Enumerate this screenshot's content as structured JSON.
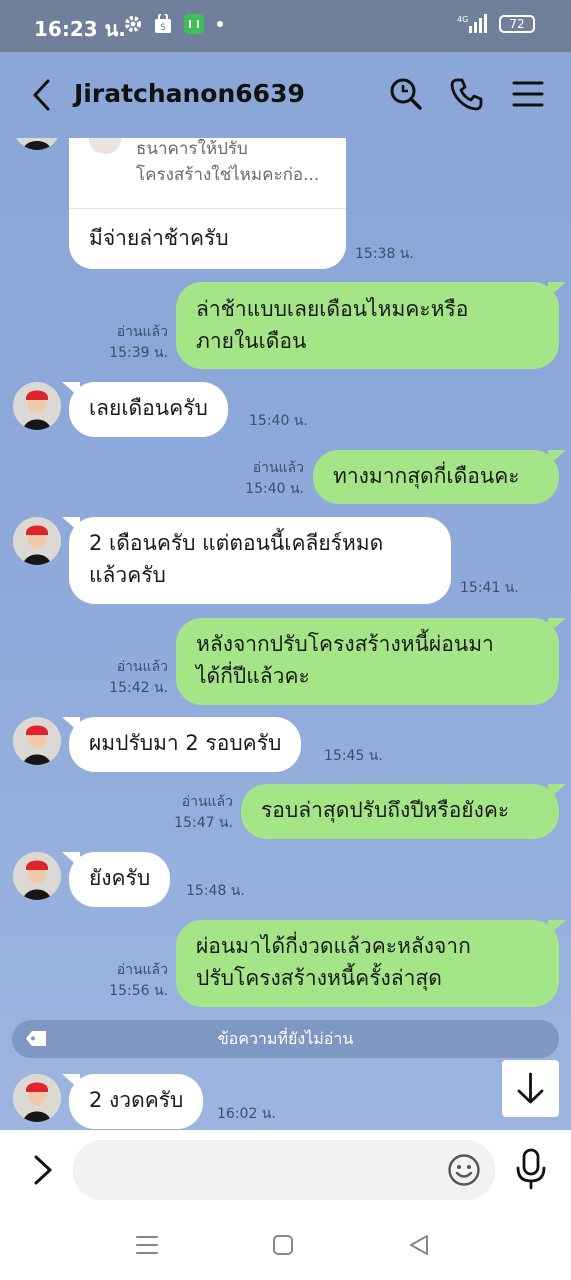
{
  "status_bar": {
    "time": "16:23 น.",
    "network": "4G",
    "battery": "72"
  },
  "header": {
    "title": "Jiratchanon6639"
  },
  "reply_card": {
    "quote_line1": "ธนาคารให้ปรับ",
    "quote_line2": "โครงสร้างใช่ไหมคะก่อ...",
    "message": "มีจ่ายล่าช้าครับ",
    "time": "15:38 น."
  },
  "messages": [
    {
      "side": "out",
      "lines": [
        "ล่าช้าแบบเลยเดือนไหมคะหรือ",
        "ภายในเดือน"
      ],
      "read": "อ่านแล้ว",
      "time": "15:39 น."
    },
    {
      "side": "in",
      "lines": [
        "เลยเดือนครับ"
      ],
      "time": "15:40 น."
    },
    {
      "side": "out",
      "lines": [
        "ทางมากสุดกี่เดือนคะ"
      ],
      "read": "อ่านแล้ว",
      "time": "15:40 น."
    },
    {
      "side": "in",
      "lines": [
        "2 เดือนครับ แต่ตอนนี้เคลียร์หมด",
        "แล้วครับ"
      ],
      "time": "15:41 น."
    },
    {
      "side": "out",
      "lines": [
        "หลังจากปรับโครงสร้างหนี้ผ่อนมา",
        "ได้กี่ปีแล้วคะ"
      ],
      "read": "อ่านแล้ว",
      "time": "15:42 น."
    },
    {
      "side": "in",
      "lines": [
        "ผมปรับมา 2 รอบครับ"
      ],
      "time": "15:45 น."
    },
    {
      "side": "out",
      "lines": [
        "รอบล่าสุดปรับถึงปีหรือยังคะ"
      ],
      "read": "อ่านแล้ว",
      "time": "15:47 น."
    },
    {
      "side": "in",
      "lines": [
        "ยังครับ"
      ],
      "time": "15:48 น."
    },
    {
      "side": "out",
      "lines": [
        "ผ่อนมาได้กี่งวดแล้วคะหลังจาก",
        "ปรับโครงสร้างหนี้ครั้งล่าสุด"
      ],
      "read": "อ่านแล้ว",
      "time": "15:56 น."
    },
    {
      "side": "in",
      "lines": [
        "2 งวดครับ"
      ],
      "time": "16:02 น."
    }
  ],
  "unread_divider": "ข้อความที่ยังไม่อ่าน",
  "input": {
    "placeholder": ""
  }
}
